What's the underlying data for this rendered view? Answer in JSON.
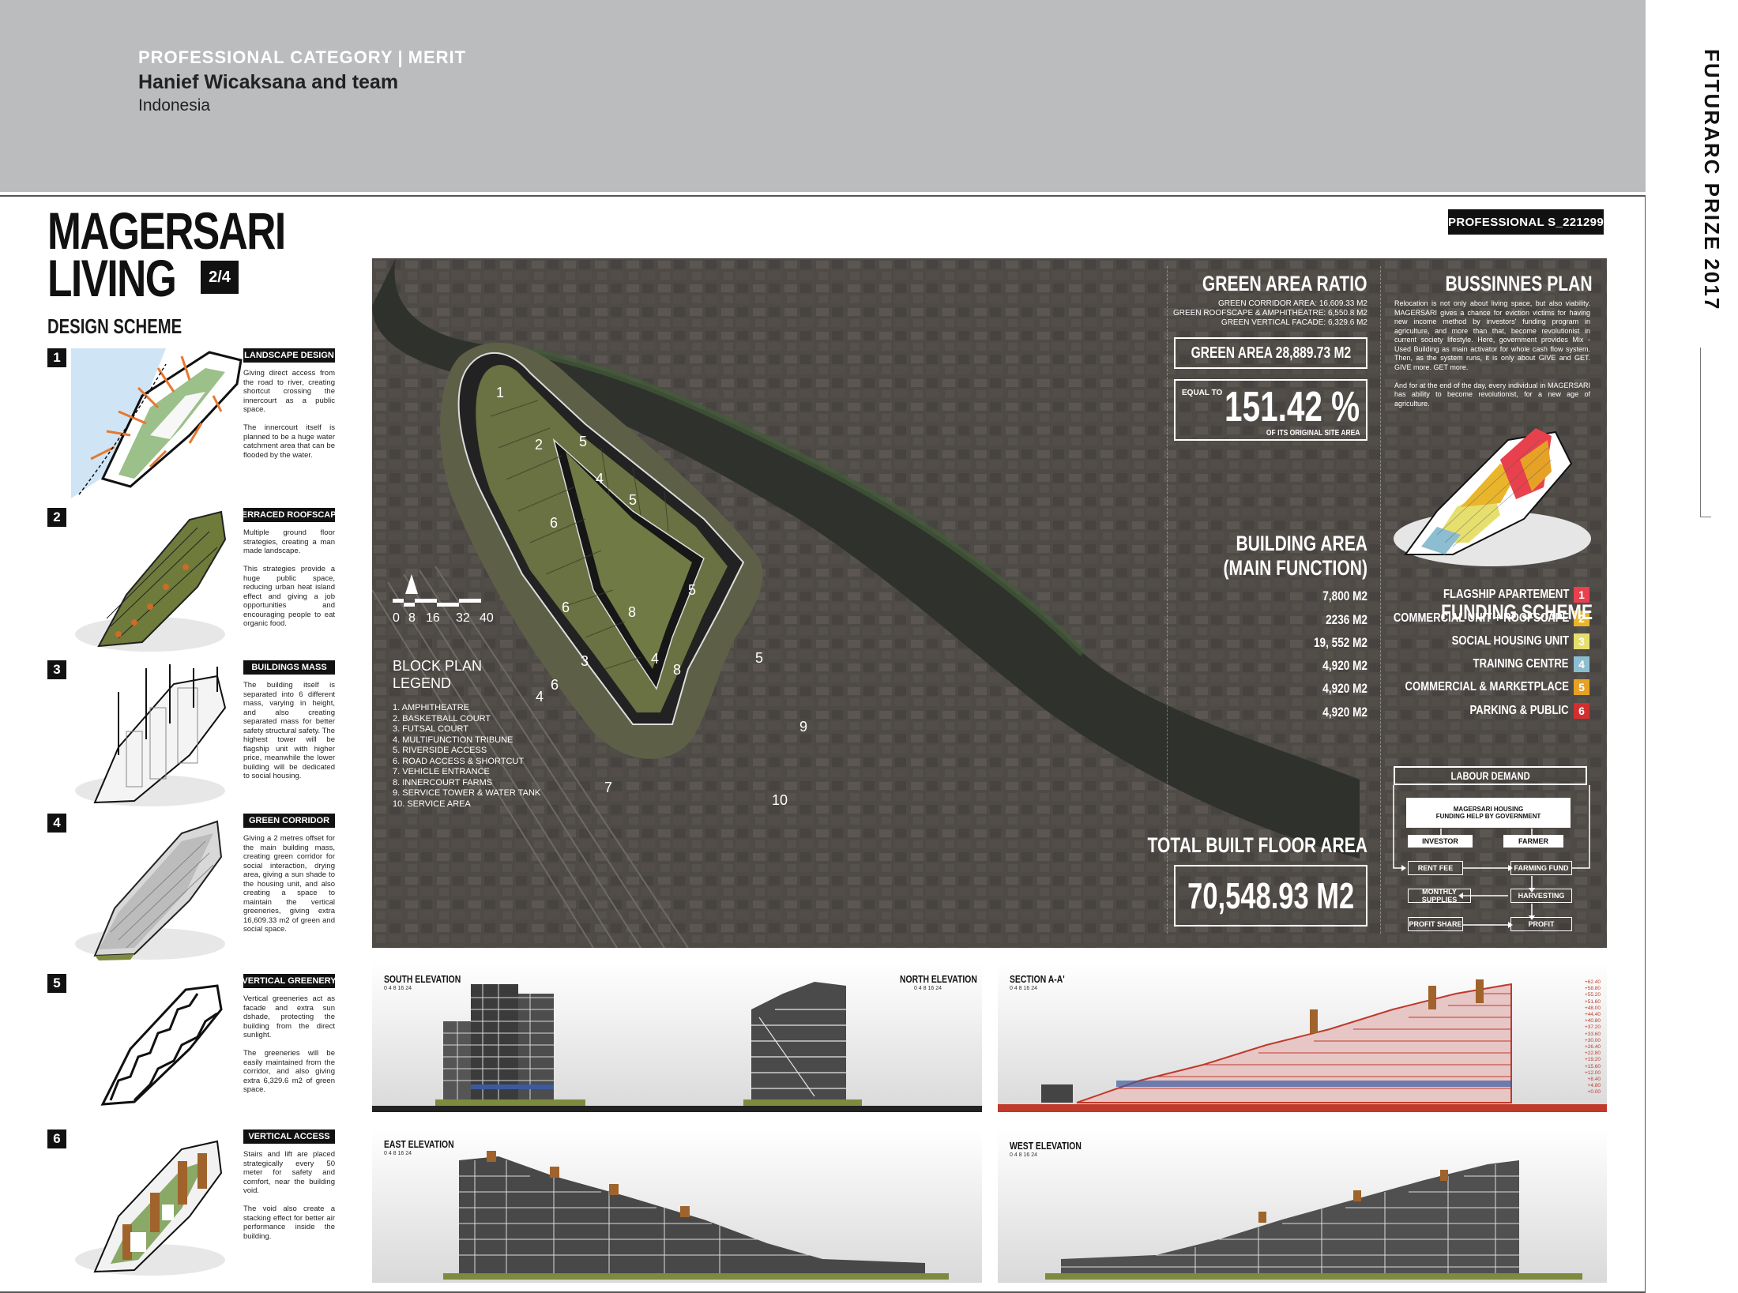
{
  "header": {
    "category": "PROFESSIONAL CATEGORY",
    "separator": "|",
    "award": "MERIT",
    "author": "Hanief Wicaksana and team",
    "country": "Indonesia"
  },
  "prize": "FUTURARC PRIZE 2017",
  "code": "PROFESSIONAL S_221299",
  "title_line1": "MAGERSARI",
  "title_line2": "LIVING",
  "page": "2/4",
  "design_scheme": {
    "title": "DESIGN SCHEME",
    "steps": [
      {
        "num": "1",
        "label": "LANDSCAPE DESIGN",
        "text": "Giving direct access from the road to river, creating shortcut crossing the innercourt as a public space.\n\nThe innercourt itself is planned to be a huge water catchment area that can be flooded by the water."
      },
      {
        "num": "2",
        "label": "TERRACED ROOFSCAPE",
        "text": "Multiple ground floor strategies, creating a man made landscape.\n\nThis strategies provide a huge public space, reducing urban heat island effect and giving a job opportunities and encouraging people to eat organic food."
      },
      {
        "num": "3",
        "label": "BUILDINGS MASS",
        "text": "The building itself is separated into 6 different mass, varying in height, and also creating separated mass for better safety structural safety. The highest tower will be flagship unit with higher price, meanwhile the lower building will be dedicated to social housing."
      },
      {
        "num": "4",
        "label": "GREEN CORRIDOR",
        "text": "Giving a 2 metres offset for the main building mass, creating green corridor for social interaction, drying area, giving a sun shade to the housing unit, and also creating a space to maintain the vertical greeneries, giving extra 16,609.33 m2 of green and social space."
      },
      {
        "num": "5",
        "label": "VERTICAL GREENERY",
        "text": "Vertical greeneries act as facade and extra sun dshade, protecting the building from the direct sunlight.\n\nThe greeneries will be easily maintained from the corridor, and also giving extra 6,329.6 m2 of green space."
      },
      {
        "num": "6",
        "label": "VERTICAL ACCESS",
        "text": "Stairs and lift are placed strategically every 50 meter for safety and comfort, near the building void.\n\nThe void also create a stacking effect for better air performance inside the building."
      }
    ]
  },
  "block_plan": {
    "scale_labels": [
      "0",
      "8",
      "16",
      "32",
      "40"
    ],
    "legend_title_1": "BLOCK PLAN",
    "legend_title_2": "LEGEND",
    "legend": [
      "1. AMPHITHEATRE",
      "2. BASKETBALL COURT",
      "3. FUTSAL COURT",
      "4. MULTIFUNCTION TRIBUNE",
      "5. RIVERSIDE ACCESS",
      "6. ROAD ACCESS & SHORTCUT",
      "7. VEHICLE ENTRANCE",
      "8. INNERCOURT FARMS",
      "9. SERVICE TOWER & WATER TANK",
      "10. SERVICE AREA"
    ],
    "numbers": [
      "1",
      "2",
      "5",
      "4",
      "5",
      "6",
      "6",
      "8",
      "5",
      "8",
      "5",
      "4",
      "3",
      "6",
      "4",
      "7",
      "9",
      "10"
    ]
  },
  "green_area": {
    "title": "GREEN AREA RATIO",
    "lines": [
      "GREEN CORRIDOR AREA: 16,609.33 M2",
      "GREEN ROOFSCAPE & AMPHITHEATRE: 6,550.8 M2",
      "GREEN VERTICAL FACADE: 6,329.6 M2"
    ],
    "total": "GREEN AREA 28,889.73 M2",
    "equal_to": "EQUAL TO",
    "ratio": "151.42 %",
    "ratio_note": "OF ITS ORIGINAL SITE AREA"
  },
  "building_area": {
    "title_1": "BUILDING AREA",
    "title_2": "(MAIN FUNCTION)",
    "values": [
      "7,800 M2",
      "2236 M2",
      "19, 552 M2",
      "4,920 M2",
      "4,920 M2",
      "4,920 M2"
    ],
    "functions": [
      {
        "label": "FLAGSHIP APARTEMENT",
        "num": "1",
        "color": "#e8414d"
      },
      {
        "label": "COMMERCIAL UNIT + ROOFSCAPE",
        "num": "2",
        "color": "#e9b52a"
      },
      {
        "label": "SOCIAL HOUSING UNIT",
        "num": "3",
        "color": "#e6df6e"
      },
      {
        "label": "TRAINING CENTRE",
        "num": "4",
        "color": "#8dbdd1"
      },
      {
        "label": "COMMERCIAL & MARKETPLACE",
        "num": "5",
        "color": "#e6a226"
      },
      {
        "label": "PARKING & PUBLIC",
        "num": "6",
        "color": "#d32f2f"
      }
    ]
  },
  "total_floor": {
    "title": "TOTAL BUILT FLOOR AREA",
    "value": "70,548.93 M2"
  },
  "business_plan": {
    "title": "BUSSINNES PLAN",
    "text": "Relocation is not only about living space, but also viability. MAGERSARI gives a chance for eviction victims for having new income method by investors' funding program in agriculture, and more than that, become revolutionist in current society lifestyle. Here, government provides Mix - Used Building as main activator for whole cash flow system. Then, as the system runs, it is only about GIVE and GET. GIVE more. GET more.\n\nAnd for at the end of the day, every individual in MAGERSARI has ability to become revolutionist, for a new age of agriculture."
  },
  "funding": {
    "title": "FUNDING SCHEME",
    "labour": "LABOUR DEMAND",
    "housing_1": "MAGERSARI HOUSING",
    "housing_2": "FUNDING HELP BY GOVERNMENT",
    "investor": "INVESTOR",
    "farmer": "FARMER",
    "rent_fee": "RENT FEE",
    "farming_fund": "FARMING FUND",
    "monthly": "MONTHLY SUPPLIES",
    "harvesting": "HARVESTING",
    "profit_share": "PROFIT SHARE",
    "profit": "PROFIT"
  },
  "elevations": {
    "south": "SOUTH ELEVATION",
    "north": "NORTH ELEVATION",
    "section": "SECTION A-A'",
    "east": "EAST ELEVATION",
    "west": "WEST ELEVATION",
    "scale": "0  4  8      16      24",
    "levels": [
      "+62.40",
      "+58.80",
      "+55.20",
      "+51.60",
      "+48.00",
      "+44.40",
      "+40.80",
      "+37.20",
      "+33.60",
      "+30.00",
      "+26.40",
      "+22.80",
      "+19.20",
      "+15.60",
      "+12.00",
      "+8.40",
      "+4.80",
      "+0.00"
    ]
  },
  "colors": {
    "header_bg": "#bbbcbe",
    "plan_bg": "#4a4846",
    "section_red": "#c0392b",
    "green": "#7d8b3f"
  }
}
